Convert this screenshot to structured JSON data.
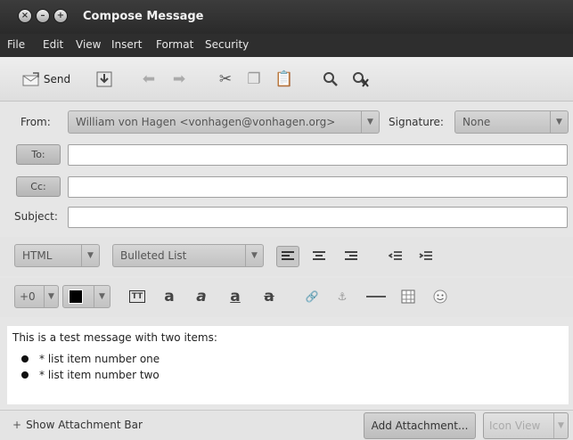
{
  "window": {
    "title": "Compose Message",
    "controls": [
      "close",
      "minimize",
      "maximize"
    ]
  },
  "menubar": {
    "items": [
      "File",
      "Edit",
      "View",
      "Insert",
      "Format",
      "Security"
    ]
  },
  "toolbar": {
    "send_label": "Send",
    "icons": [
      "send-icon",
      "save-icon",
      "undo-icon",
      "redo-icon",
      "cut-icon",
      "copy-icon",
      "paste-icon",
      "find-icon",
      "spellcheck-icon"
    ]
  },
  "from": {
    "label": "From:",
    "value": "William von Hagen <vonhagen@vonhagen.org>"
  },
  "signature": {
    "label": "Signature:",
    "value": "None"
  },
  "to": {
    "button_label": "To:",
    "value": ""
  },
  "cc": {
    "button_label": "Cc:",
    "value": ""
  },
  "subject": {
    "label": "Subject:",
    "value": ""
  },
  "format": {
    "mode": "HTML",
    "paragraph_style": "Bulleted List",
    "font_size": "+0"
  },
  "message": {
    "intro": "This is a test message with two items:",
    "items": [
      "* list item number one",
      "* list item number two"
    ]
  },
  "footer": {
    "attachment_bar_label": "Show Attachment Bar",
    "add_attachment_label": "Add Attachment...",
    "view_mode": "Icon View"
  }
}
